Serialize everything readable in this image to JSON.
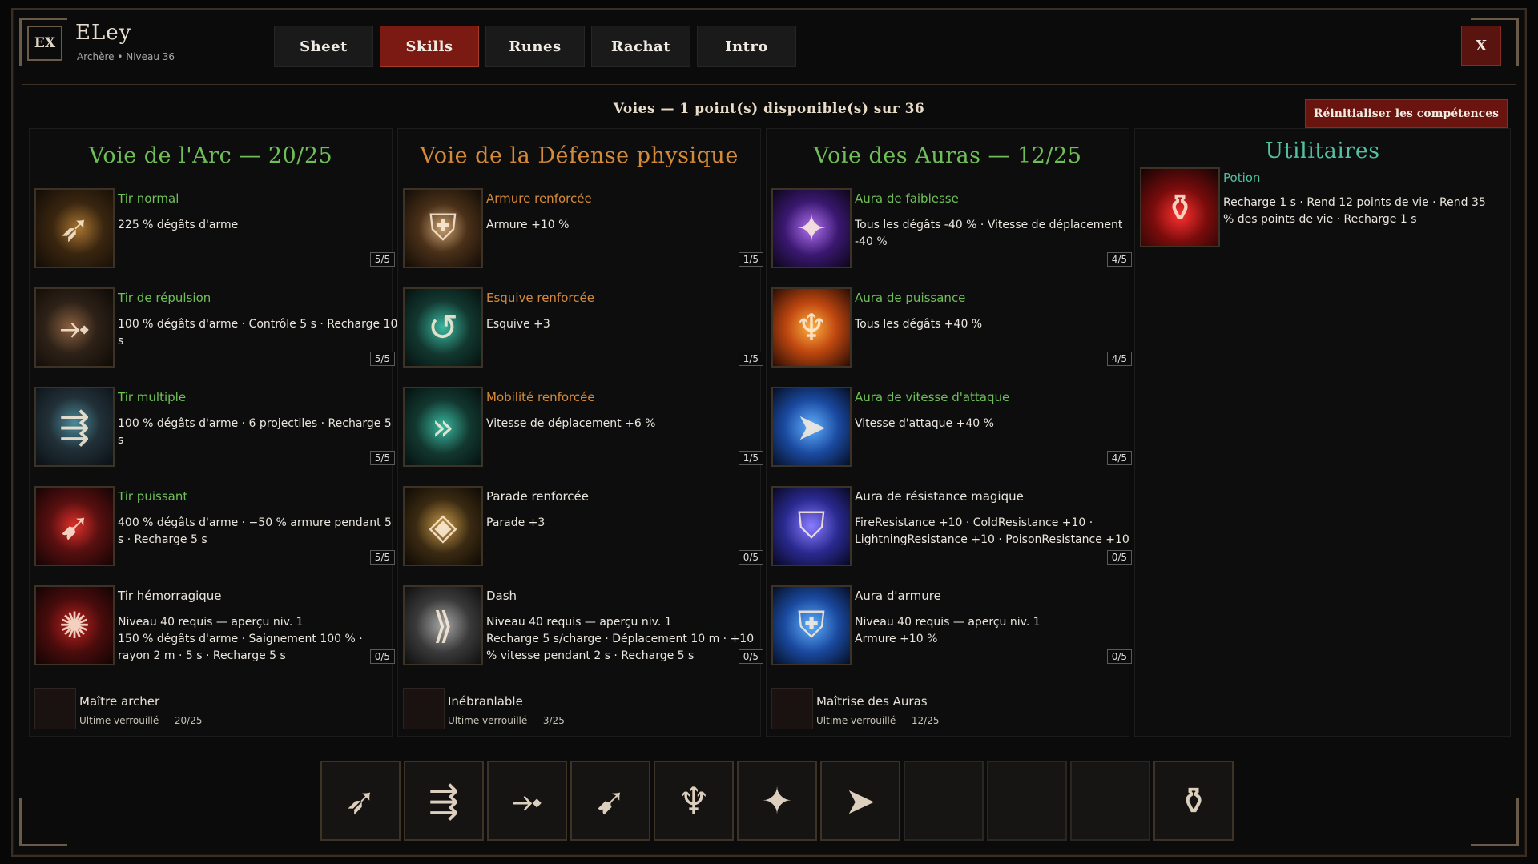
{
  "header": {
    "badge": "EX",
    "name": "ELey",
    "subtitle": "Archère • Niveau 36",
    "tabs": [
      "Sheet",
      "Skills",
      "Runes",
      "Rachat",
      "Intro"
    ],
    "active_tab": "Skills",
    "close": "X"
  },
  "voies": {
    "title": "Voies — 1 point(s) disponible(s) sur 36",
    "reset": "Réinitialiser les compétences"
  },
  "columns": [
    {
      "title": "Voie de l'Arc — 20/25",
      "skills": [
        {
          "name": "Tir normal",
          "desc": "225 % dégâts d'arme",
          "level": "5/5",
          "icon": "arrow-icon"
        },
        {
          "name": "Tir de répulsion",
          "desc": "100 % dégâts d'arme · Contrôle 5 s · Recharge 10 s",
          "level": "5/5",
          "icon": "repel-arrow-icon"
        },
        {
          "name": "Tir multiple",
          "desc": "100 % dégâts d'arme · 6 projectiles · Recharge 5 s",
          "level": "5/5",
          "icon": "multi-arrow-icon"
        },
        {
          "name": "Tir puissant",
          "desc": "400 % dégâts d'arme · −50 % armure pendant 5 s · Recharge 5 s",
          "level": "5/5",
          "icon": "power-shot-icon"
        },
        {
          "name": "Tir hémorragique",
          "desc": "Niveau 40 requis — aperçu niv. 1\n150 % dégâts d'arme · Saignement 100 % · rayon 2 m · 5 s · Recharge 5 s",
          "level": "0/5",
          "icon": "bleed-shot-icon"
        }
      ],
      "ultimate": {
        "name": "Maître archer",
        "sub": "Ultime verrouillé — 20/25"
      }
    },
    {
      "title": "Voie de la Défense physique",
      "skills": [
        {
          "name": "Armure renforcée",
          "desc": "Armure +10 %",
          "level": "1/5",
          "icon": "armor-icon"
        },
        {
          "name": "Esquive renforcée",
          "desc": "Esquive +3",
          "level": "1/5",
          "icon": "dodge-icon"
        },
        {
          "name": "Mobilité renforcée",
          "desc": "Vitesse de déplacement +6 %",
          "level": "1/5",
          "icon": "mobility-icon"
        },
        {
          "name": "Parade renforcée",
          "desc": "Parade +3",
          "level": "0/5",
          "icon": "parry-shield-icon"
        },
        {
          "name": "Dash",
          "desc": "Niveau 40 requis — aperçu niv. 1\nRecharge 5 s/charge · Déplacement 10 m · +10 % vitesse pendant 2 s · Recharge 5 s",
          "level": "0/5",
          "icon": "dash-icon"
        }
      ],
      "ultimate": {
        "name": "Inébranlable",
        "sub": "Ultime verrouillé — 3/25"
      }
    },
    {
      "title": "Voie des Auras — 12/25",
      "skills": [
        {
          "name": "Aura de faiblesse",
          "desc": "Tous les dégâts -40 % · Vitesse de déplacement -40 %",
          "level": "4/5",
          "icon": "weakness-aura-icon"
        },
        {
          "name": "Aura de puissance",
          "desc": "Tous les dégâts +40 %",
          "level": "4/5",
          "icon": "power-aura-icon"
        },
        {
          "name": "Aura de vitesse d'attaque",
          "desc": "Vitesse d'attaque +40 %",
          "level": "4/5",
          "icon": "speed-aura-icon"
        },
        {
          "name": "Aura de résistance magique",
          "desc": "FireResistance +10 · ColdResistance +10 · LightningResistance +10 · PoisonResistance +10",
          "level": "0/5",
          "icon": "magic-resist-aura-icon"
        },
        {
          "name": "Aura d'armure",
          "desc": "Niveau 40 requis — aperçu niv. 1\nArmure +10 %",
          "level": "0/5",
          "icon": "armor-aura-icon"
        }
      ],
      "ultimate": {
        "name": "Maîtrise des Auras",
        "sub": "Ultime verrouillé — 12/25"
      }
    },
    {
      "title": "Utilitaires",
      "skills": [
        {
          "name": "Potion",
          "desc": "Recharge 1 s · Rend 12 points de vie · Rend 35 % des points de vie · Recharge 1 s",
          "icon": "potion-icon"
        }
      ]
    }
  ],
  "colors": {
    "green": "#6fbf58",
    "orange": "#d58a3a",
    "teal": "#53c0a0",
    "active_tab": "#7a1a12"
  }
}
